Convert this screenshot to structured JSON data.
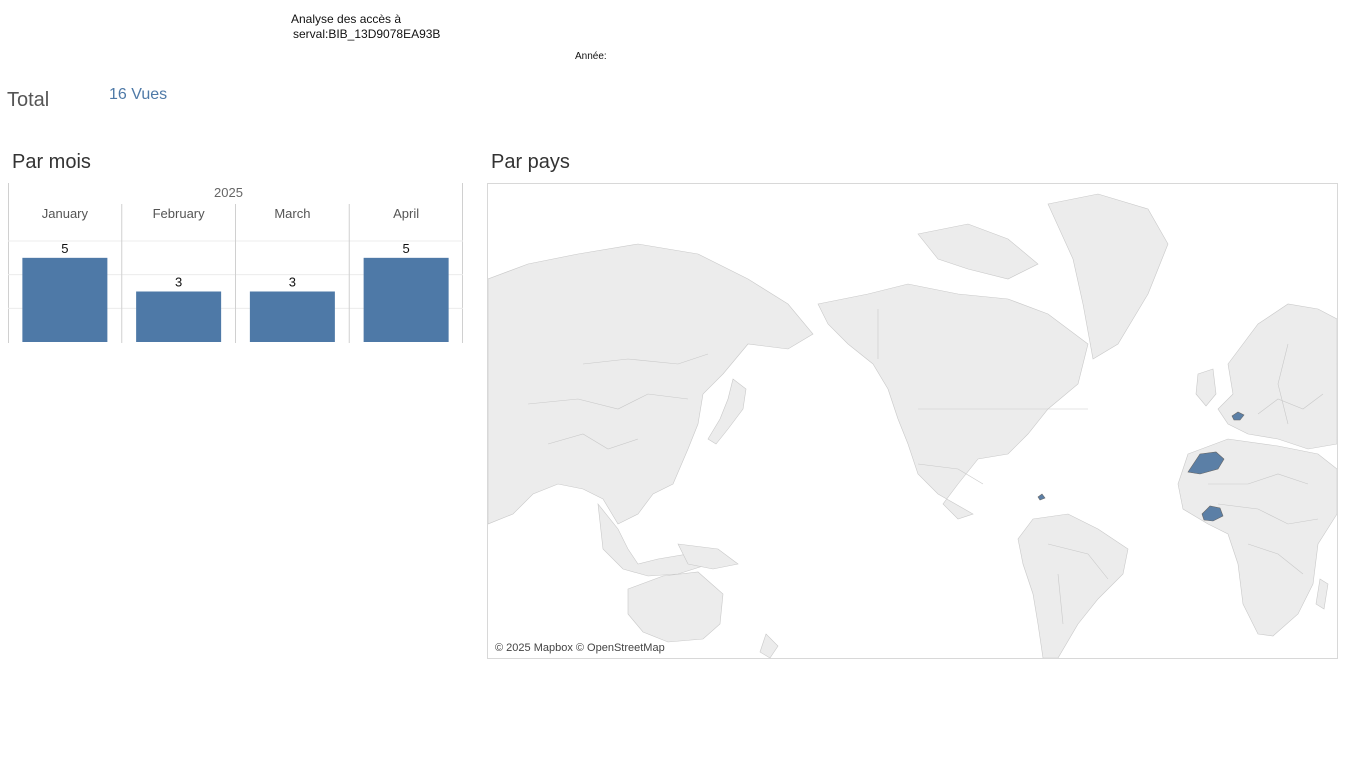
{
  "header": {
    "title_line1": "Analyse des accès à",
    "title_line2": "serval:BIB_13D9078EA93B",
    "year_filter_label": "Année:"
  },
  "total": {
    "label": "Total",
    "value": "16 Vues"
  },
  "sections": {
    "bar_title": "Par mois",
    "map_title": "Par pays"
  },
  "chart_data": {
    "type": "bar",
    "title": "Par mois",
    "group_label": "2025",
    "categories": [
      "January",
      "February",
      "March",
      "April"
    ],
    "values": [
      5,
      3,
      3,
      5
    ],
    "ylim": [
      0,
      6
    ],
    "grid": true,
    "color": "#4e79a7"
  },
  "map": {
    "attribution": "© 2025 Mapbox © OpenStreetMap",
    "land_color": "#ececec",
    "border_color": "#c9c9c9",
    "highlight_color": "#5b7fa6",
    "highlighted_countries": [
      "Morocco",
      "Burkina Faso",
      "Switzerland",
      "Haiti"
    ]
  }
}
